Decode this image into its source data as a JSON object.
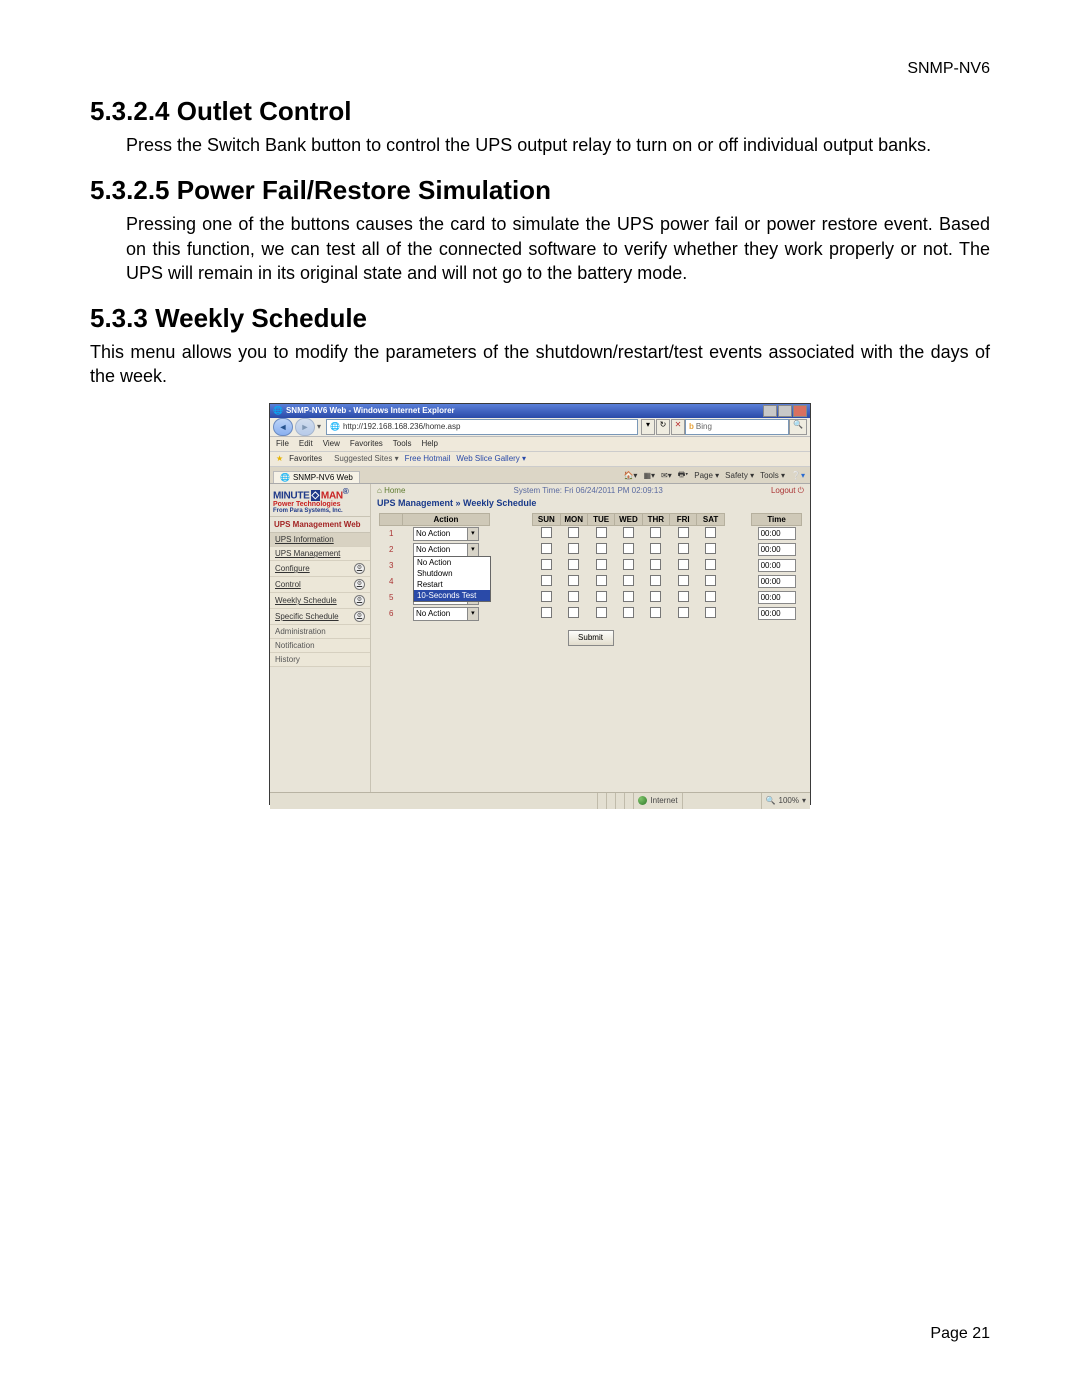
{
  "doc_header": "SNMP-NV6",
  "sections": {
    "s1": {
      "num": "5.3.2.4",
      "title": "Outlet Control",
      "body": "Press the Switch Bank button to control the UPS output relay to turn on or off individual output banks."
    },
    "s2": {
      "num": "5.3.2.5",
      "title": "Power Fail/Restore Simulation",
      "body": "Pressing one of the buttons causes the card to simulate the UPS power fail or power restore event. Based on this function, we can test all of the connected software to verify whether they work properly or not. The UPS will remain in its original state and will not go to the battery mode."
    },
    "s3": {
      "num": "5.3.3",
      "title": "Weekly Schedule",
      "body": "This menu allows you to modify the parameters of the shutdown/restart/test events associated with the days of the week."
    }
  },
  "page_footer": "Page 21",
  "window": {
    "title": "SNMP-NV6 Web - Windows Internet Explorer",
    "address": "http://192.168.168.236/home.asp",
    "search_placeholder": "Bing",
    "menus": [
      "File",
      "Edit",
      "View",
      "Favorites",
      "Tools",
      "Help"
    ],
    "favbar": {
      "label": "Favorites",
      "link1": "Suggested Sites ▾",
      "link2": "Free Hotmail",
      "link3": "Web Slice Gallery ▾"
    },
    "tab": "SNMP-NV6 Web",
    "right_tools": [
      "Page ▾",
      "Safety ▾",
      "Tools ▾"
    ]
  },
  "app": {
    "logo1a": "MINUTE",
    "logo1b": "MAN",
    "logo_reg": "®",
    "logo2": "Power Technologies",
    "logo3": "From Para Systems, Inc.",
    "side_header": "UPS Management Web",
    "side": [
      {
        "label": "UPS Information",
        "cog": false,
        "sel": true
      },
      {
        "label": "UPS Management",
        "cog": false,
        "sel": false
      },
      {
        "label": "Configure",
        "cog": true,
        "sel": false
      },
      {
        "label": "Control",
        "cog": true,
        "sel": false
      },
      {
        "label": "Weekly Schedule",
        "cog": true,
        "sel": false
      },
      {
        "label": "Specific Schedule",
        "cog": true,
        "sel": false
      },
      {
        "label": "Administration",
        "cog": false,
        "sel": false,
        "plain": true
      },
      {
        "label": "Notification",
        "cog": false,
        "sel": false,
        "plain": true
      },
      {
        "label": "History",
        "cog": false,
        "sel": false,
        "plain": true
      }
    ],
    "home": "Home",
    "system_time": "System Time: Fri 06/24/2011 PM 02:09:13",
    "logout": "Logout",
    "breadcrumb": "UPS Management » Weekly Schedule",
    "cols": {
      "action": "Action",
      "days": [
        "SUN",
        "MON",
        "TUE",
        "WED",
        "THR",
        "FRI",
        "SAT"
      ],
      "time": "Time"
    },
    "rows": [
      {
        "idx": "1",
        "action": "No Action",
        "time": "00:00",
        "open": false
      },
      {
        "idx": "2",
        "action": "No Action",
        "time": "00:00",
        "open": true
      },
      {
        "idx": "3",
        "action": "No Action",
        "time": "00:00",
        "open": false
      },
      {
        "idx": "4",
        "action": "No Action",
        "time": "00:00",
        "open": false
      },
      {
        "idx": "5",
        "action": "No Action",
        "time": "00:00",
        "open": false
      },
      {
        "idx": "6",
        "action": "No Action",
        "time": "00:00",
        "open": false
      }
    ],
    "dropdown_options": [
      "No Action",
      "Shutdown",
      "Restart",
      "10-Seconds Test"
    ],
    "dropdown_highlight": "10-Seconds Test",
    "submit": "Submit"
  },
  "status": {
    "zone": "Internet",
    "zoom": "100%"
  }
}
